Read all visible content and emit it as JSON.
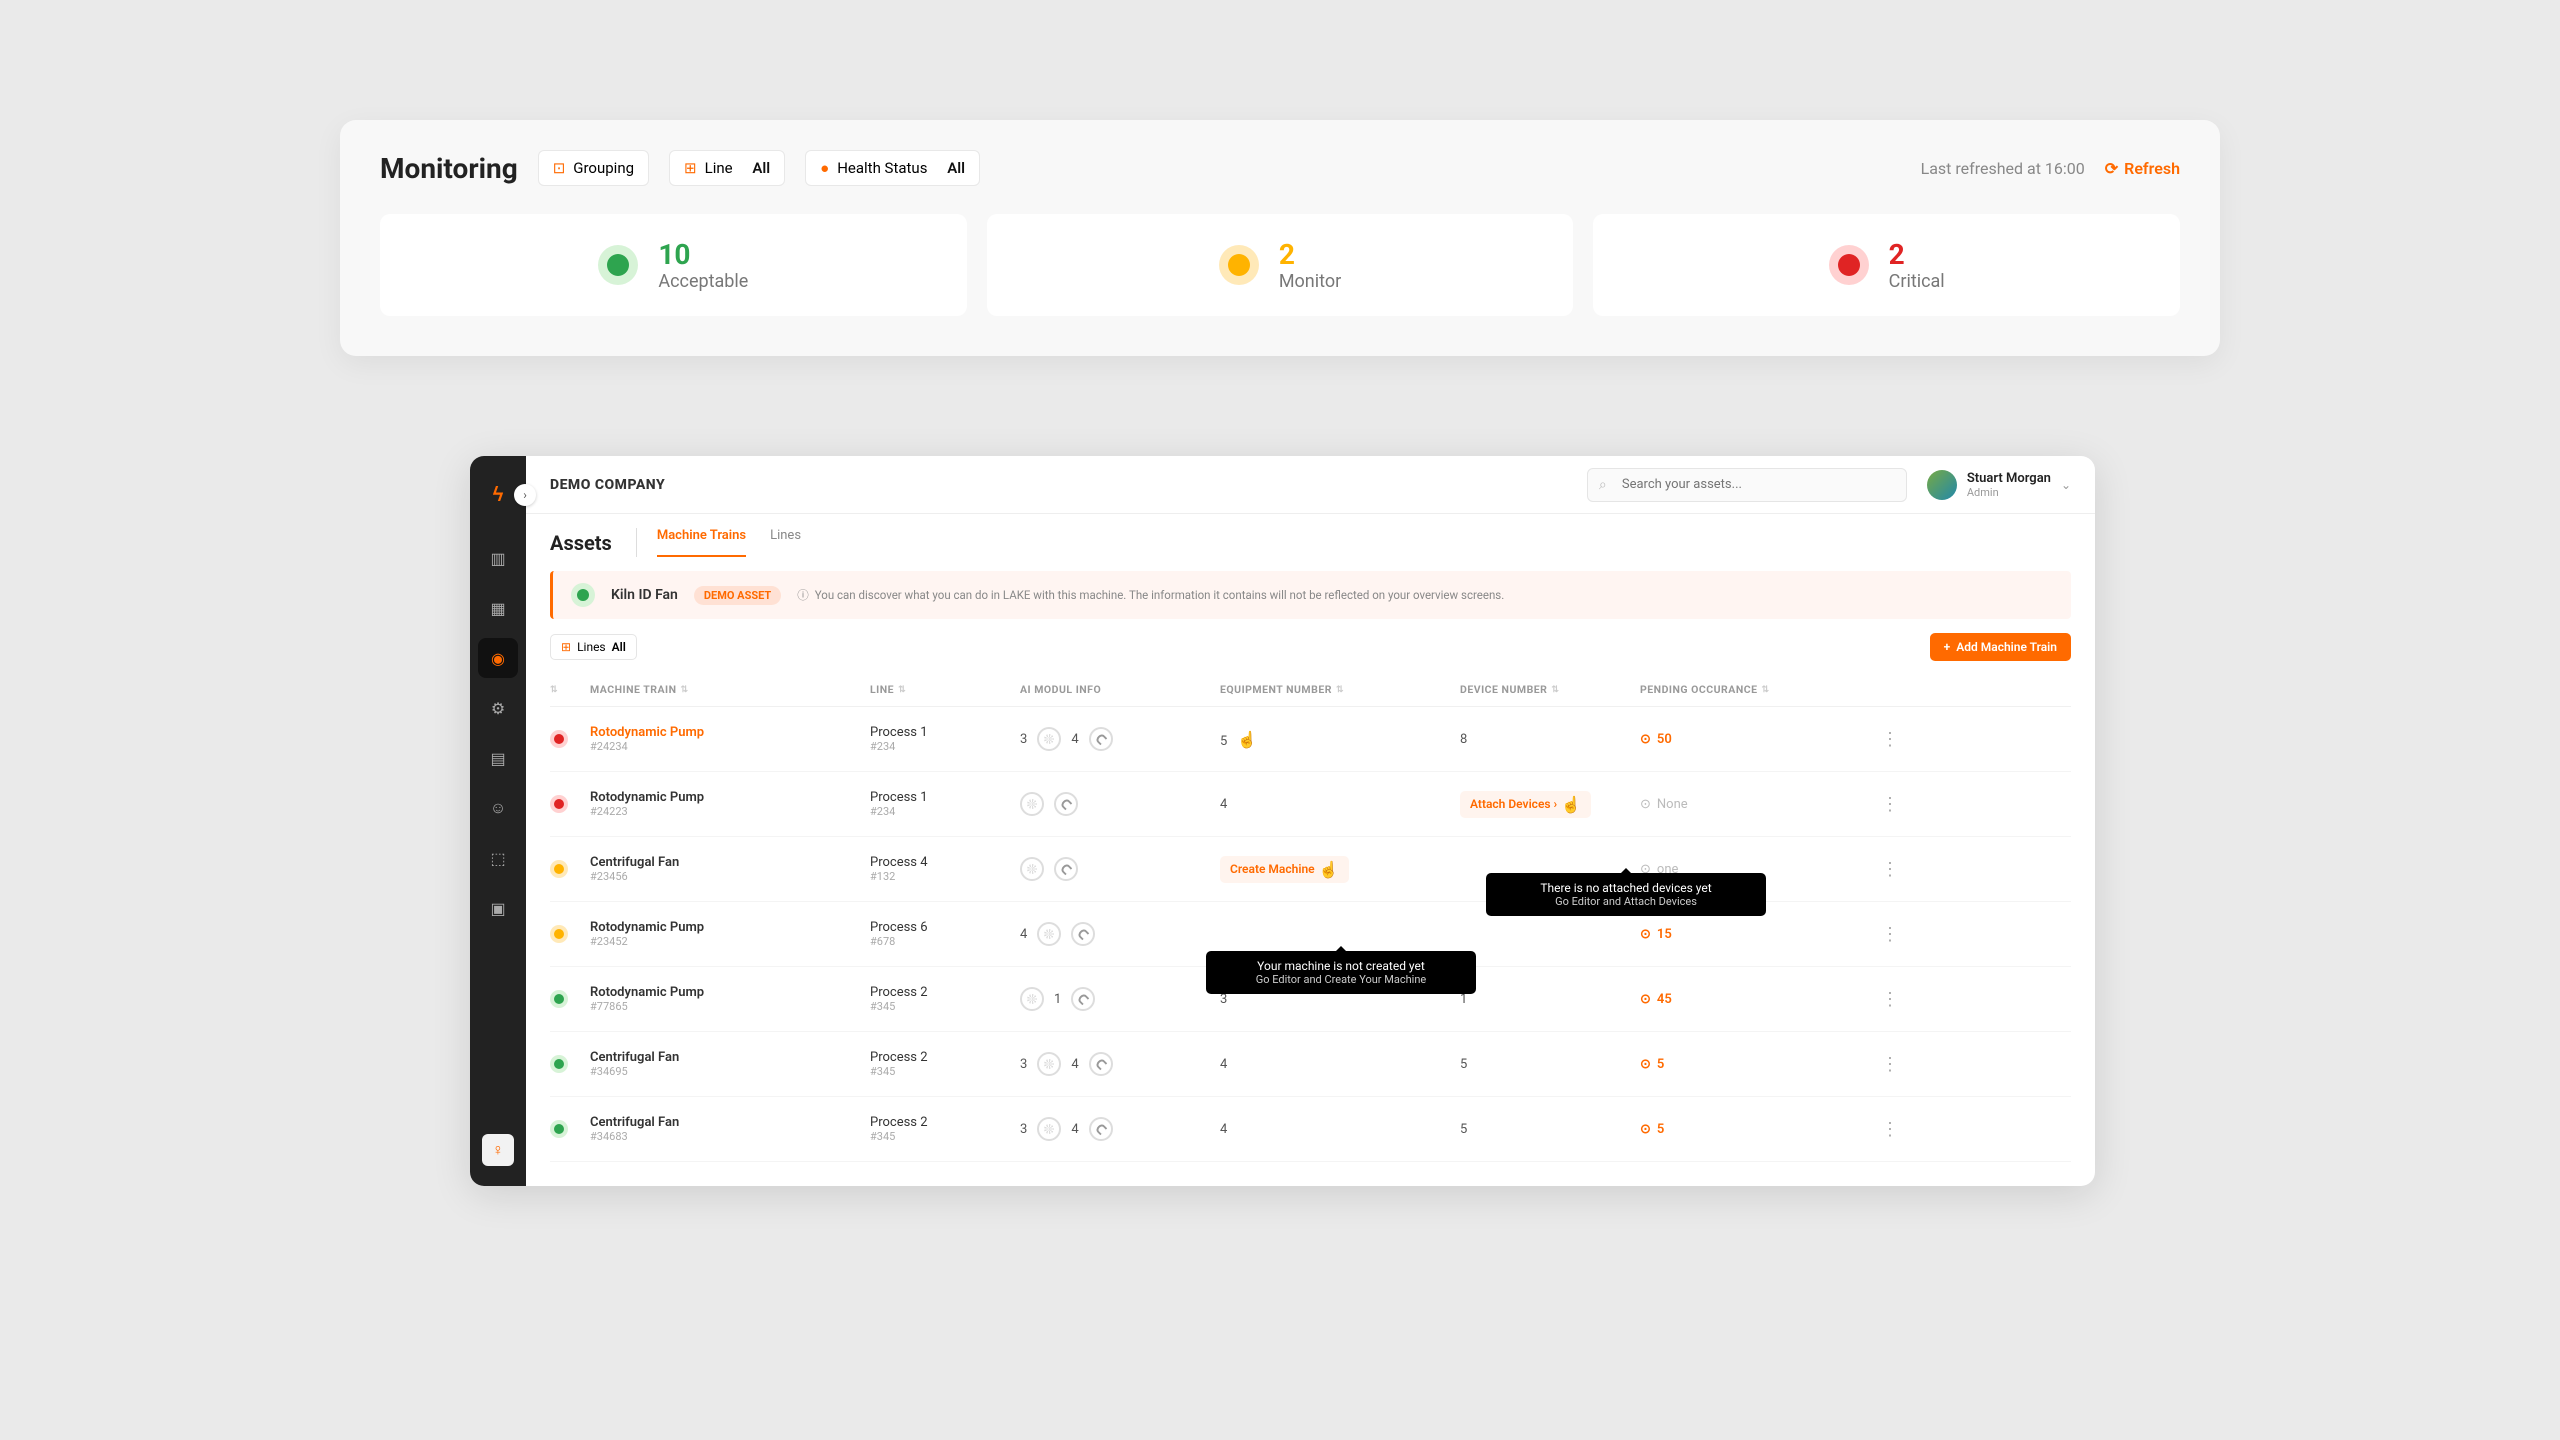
{
  "monitoring": {
    "title": "Monitoring",
    "filters": {
      "grouping": "Grouping",
      "line_label": "Line",
      "line_value": "All",
      "health_label": "Health Status",
      "health_value": "All"
    },
    "refresh_text": "Last refreshed at 16:00",
    "refresh_btn": "Refresh",
    "cards": [
      {
        "count": "10",
        "label": "Acceptable",
        "color": "green"
      },
      {
        "count": "2",
        "label": "Monitor",
        "color": "yellow"
      },
      {
        "count": "2",
        "label": "Critical",
        "color": "red"
      }
    ]
  },
  "app": {
    "company": "DEMO COMPANY",
    "search_placeholder": "Search your assets...",
    "user": {
      "name": "Stuart Morgan",
      "role": "Admin"
    },
    "assets_title": "Assets",
    "tabs": [
      {
        "label": "Machine Trains",
        "active": true
      },
      {
        "label": "Lines",
        "active": false
      }
    ],
    "banner": {
      "name": "Kiln ID Fan",
      "badge": "DEMO ASSET",
      "hint": "You can discover what you can do in LAKE with this machine. The information it contains will not be reflected on your overview screens."
    },
    "lines_chip": {
      "label": "Lines",
      "value": "All"
    },
    "add_btn": "Add Machine Train",
    "columns": [
      "",
      "MACHINE TRAIN",
      "LINE",
      "AI MODUL INFO",
      "EQUIPMENT NUMBER",
      "DEVICE NUMBER",
      "PENDING OCCURANCE",
      ""
    ],
    "rows": [
      {
        "status": "red",
        "name": "Rotodynamic Pump",
        "name_orange": true,
        "asset_id": "#24234",
        "line": "Process 1",
        "line_id": "#234",
        "ai": [
          3,
          4
        ],
        "equipment": "5",
        "equipment_cursor": true,
        "device": "8",
        "pending": "50",
        "pending_muted": false
      },
      {
        "status": "red",
        "name": "Rotodynamic Pump",
        "asset_id": "#24223",
        "line": "Process 1",
        "line_id": "#234",
        "ai_empty": true,
        "equipment": "4",
        "device_link": "Attach Devices",
        "device_cursor": true,
        "pending": "None",
        "pending_muted": true
      },
      {
        "status": "yellow",
        "name": "Centrifugal Fan",
        "asset_id": "#23456",
        "line": "Process 4",
        "line_id": "#132",
        "ai_empty": true,
        "equipment_link": "Create Machine",
        "equipment_cursor": true,
        "device": "",
        "pending": "one",
        "pending_muted": true
      },
      {
        "status": "yellow",
        "name": "Rotodynamic Pump",
        "asset_id": "#23452",
        "line": "Process 6",
        "line_id": "#678",
        "ai": [
          4,
          null
        ],
        "equipment": "",
        "device": "",
        "pending": "15",
        "pending_muted": false
      },
      {
        "status": "green",
        "name": "Rotodynamic Pump",
        "asset_id": "#77865",
        "line": "Process 2",
        "line_id": "#345",
        "ai": [
          null,
          1
        ],
        "equipment": "3",
        "device": "1",
        "pending": "45",
        "pending_muted": false
      },
      {
        "status": "green",
        "name": "Centrifugal Fan",
        "asset_id": "#34695",
        "line": "Process 2",
        "line_id": "#345",
        "ai": [
          3,
          4
        ],
        "equipment": "4",
        "device": "5",
        "pending": "5",
        "pending_muted": false
      },
      {
        "status": "green",
        "name": "Centrifugal Fan",
        "asset_id": "#34683",
        "line": "Process 2",
        "line_id": "#345",
        "ai": [
          3,
          4
        ],
        "equipment": "4",
        "device": "5",
        "pending": "5",
        "pending_muted": false
      }
    ],
    "tooltip1": {
      "title": "Your machine is not created yet",
      "sub": "Go Editor and Create Your Machine"
    },
    "tooltip2": {
      "title": "There is no attached devices yet",
      "sub": "Go Editor and Attach Devices"
    }
  }
}
